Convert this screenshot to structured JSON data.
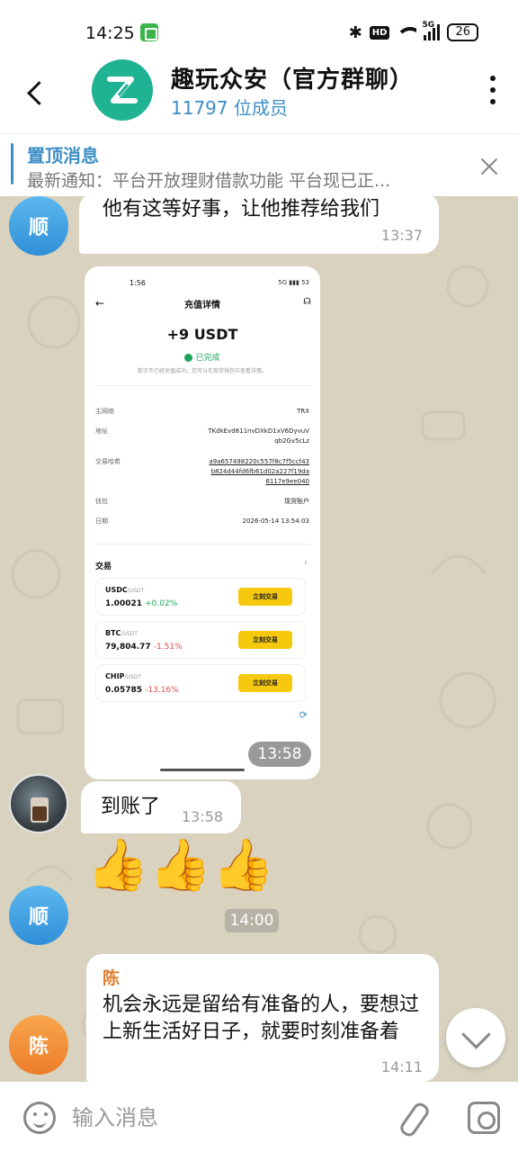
{
  "status_bar": {
    "time": "14:25",
    "hd": "HD",
    "network": "5G",
    "battery": "26"
  },
  "header": {
    "title": "趣玩众安（官方群聊）",
    "subtitle": "11797 位成员"
  },
  "pinned": {
    "title": "置顶消息",
    "text": "最新通知：平台开放理财借款功能 平台现已正..."
  },
  "messages": {
    "m1": {
      "avatar": "顺",
      "text": "他有这等好事，让他推荐给我们",
      "time": "13:37"
    },
    "m2": {
      "time": "13:58"
    },
    "m3": {
      "text": "到账了",
      "time": "13:58"
    },
    "m4": {
      "avatar": "顺",
      "text": "👍👍👍",
      "time": "14:00"
    },
    "m5": {
      "avatar": "陈",
      "sender": "陈",
      "text": "机会永远是留给有准备的人，要想过上新生活好日子，就要时刻准备着",
      "time": "14:11"
    }
  },
  "screenshot": {
    "status_time": "1:56",
    "status_right": "5G ▮▮▮ 53",
    "title": "充值详情",
    "amount": "+9 USDT",
    "status": "已完成",
    "note": "数字币已经充值成功，您可以在现货钱包中查看详情。",
    "rows": [
      {
        "label": "主网络",
        "value": "TRX"
      },
      {
        "label": "地址",
        "value": "TKdkEvd811nvDXkD1xV6DyvuV qb2Gv5cLz"
      },
      {
        "label": "交易哈希",
        "value": "a9a657498220c557f8c7f5ccf43 b824d44fd6fb61d02a227f19da 6117e9ee040"
      },
      {
        "label": "钱包",
        "value": "现货账户"
      },
      {
        "label": "日期",
        "value": "2026-05-14 13:54:03"
      }
    ],
    "section": "交易",
    "markets": [
      {
        "pair": "USDC",
        "quote": "/USDT",
        "price": "1.00021",
        "change": "+0.02%",
        "direction": "up",
        "button": "立刻交易"
      },
      {
        "pair": "BTC",
        "quote": "/USDT",
        "price": "79,804.77",
        "change": "-1.51%",
        "direction": "down",
        "button": "立刻交易"
      },
      {
        "pair": "CHIP",
        "quote": "/USDT",
        "price": "0.05785",
        "change": "-13.16%",
        "direction": "down",
        "button": "立刻交易"
      }
    ]
  },
  "composer": {
    "placeholder": "输入消息"
  },
  "colors": {
    "accent": "#3d8ec6",
    "brand": "#1fb394",
    "chat_bg": "#d8d2bf",
    "orange": "#ee7d2a",
    "trade_button": "#f6c90e"
  }
}
